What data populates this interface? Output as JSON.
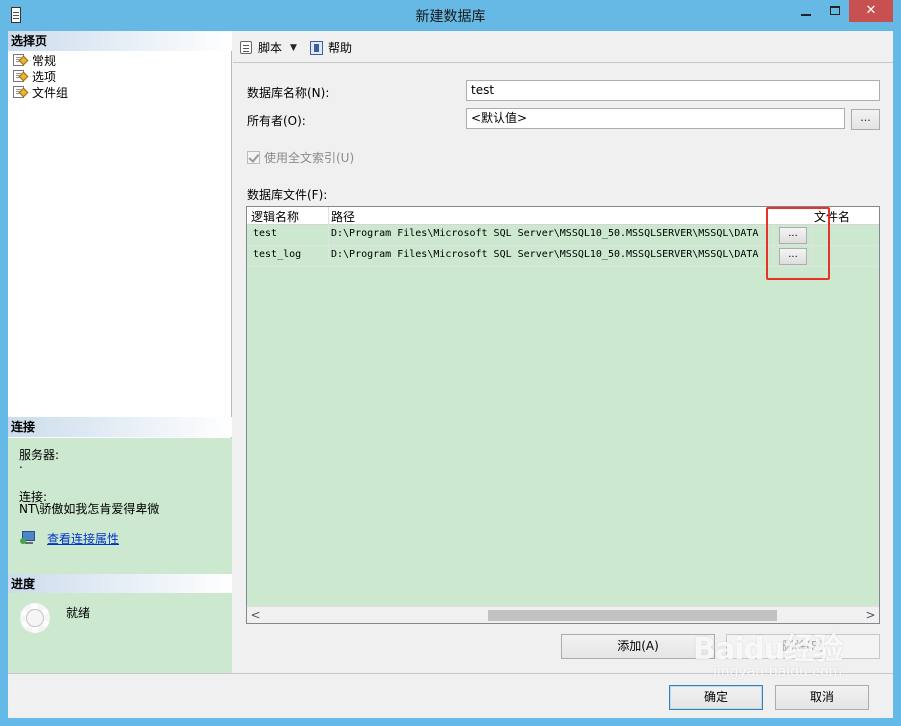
{
  "window": {
    "title": "新建数据库",
    "min_label": "",
    "close_label": "✕"
  },
  "left_panel": {
    "select_page_header": "选择页",
    "pages": [
      {
        "label": "常规"
      },
      {
        "label": "选项"
      },
      {
        "label": "文件组"
      }
    ],
    "connection_header": "连接",
    "server_label": "服务器:",
    "server_value": ".",
    "connection_label": "连接:",
    "connection_value": "NT\\骄傲如我怎肯爱得卑微",
    "view_properties_link": "查看连接属性",
    "progress_header": "进度",
    "progress_status": "就绪"
  },
  "toolbar": {
    "script_label": "脚本",
    "help_label": "帮助"
  },
  "form": {
    "db_name_label": "数据库名称(N):",
    "db_name_value": "test",
    "owner_label": "所有者(O):",
    "owner_value": "<默认值>",
    "owner_browse": "...",
    "fulltext_label": "使用全文索引(U)",
    "fulltext_checked": true,
    "db_files_label": "数据库文件(F):"
  },
  "files_grid": {
    "columns": [
      "逻辑名称",
      "路径",
      "文件名"
    ],
    "rows": [
      {
        "logical_name": "test",
        "path": "D:\\Program Files\\Microsoft SQL Server\\MSSQL10_50.MSSQLSERVER\\MSSQL\\DATA",
        "browse": "..."
      },
      {
        "logical_name": "test_log",
        "path": "D:\\Program Files\\Microsoft SQL Server\\MSSQL10_50.MSSQLSERVER\\MSSQL\\DATA",
        "browse": "..."
      }
    ]
  },
  "buttons": {
    "add": "添加(A)",
    "remove": "删除(R)",
    "ok": "确定",
    "cancel": "取消"
  },
  "watermark": {
    "main": "Baidu经验",
    "sub": "jingyan.baidu.com"
  },
  "colors": {
    "title_bar": "#66b8e5",
    "grid_background": "#cce8cf",
    "highlight_border": "#e8312b",
    "link": "#0033cc"
  }
}
